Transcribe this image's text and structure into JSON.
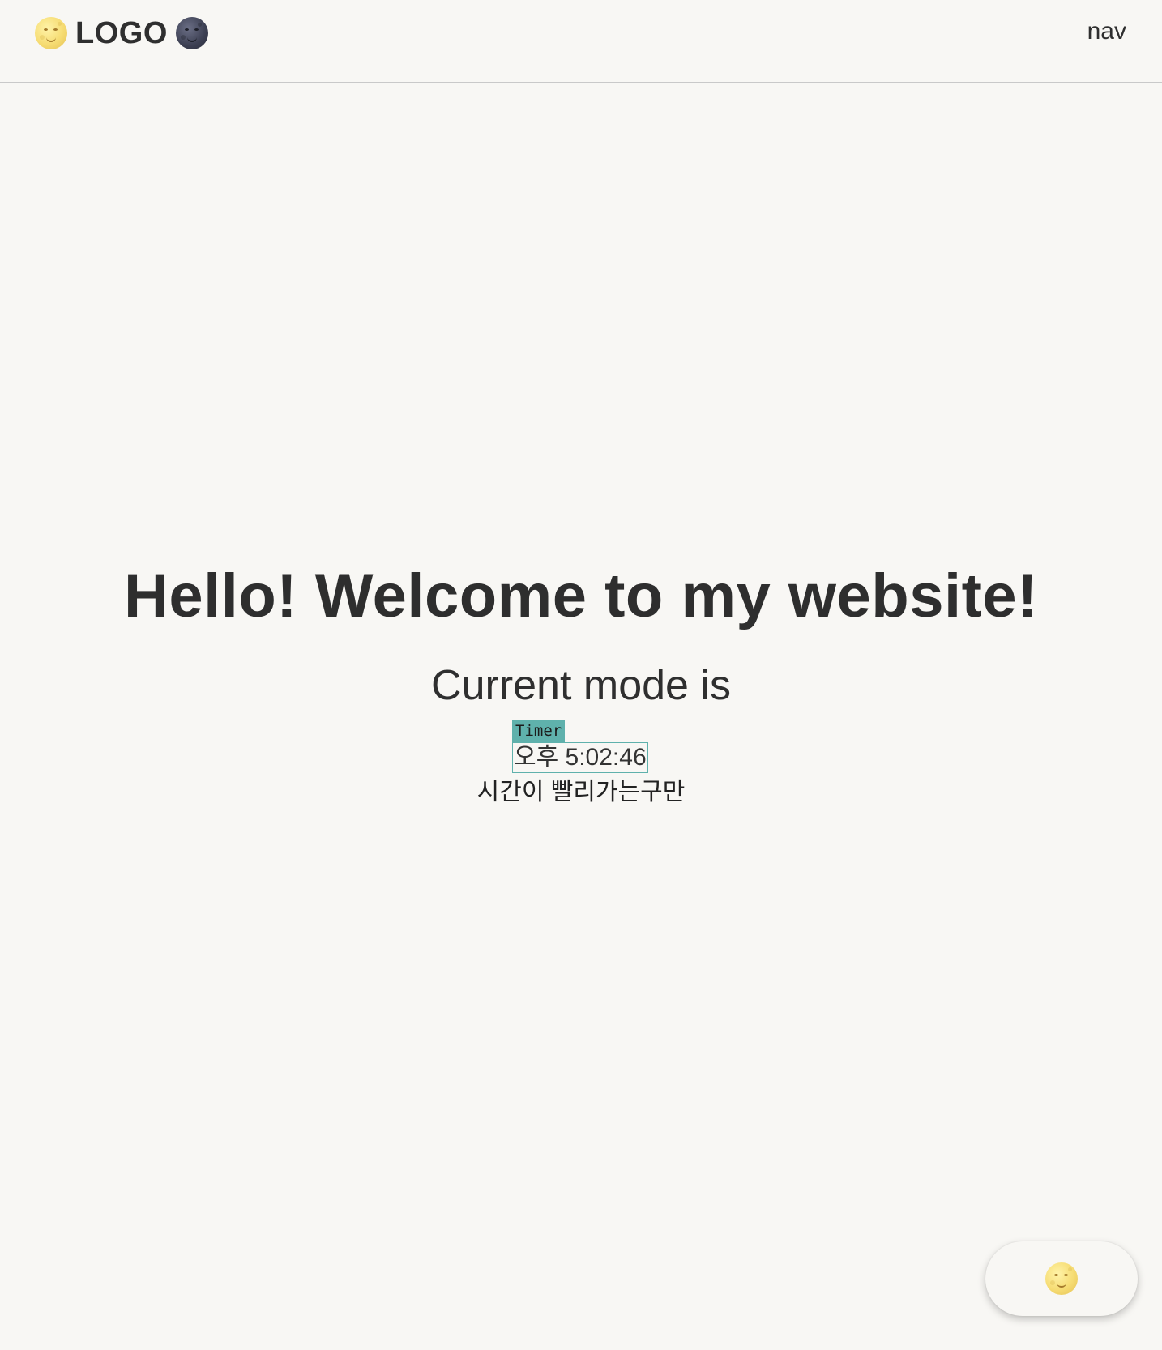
{
  "header": {
    "logo_text": "LOGO",
    "logo_left_icon": "full-moon-face-icon",
    "logo_right_icon": "new-moon-face-icon",
    "nav_label": "nav"
  },
  "main": {
    "title": "Hello! Welcome to my website!",
    "mode_text": "Current mode is",
    "timer_label": "Timer",
    "timer_value": "오후 5:02:46",
    "subtext": "시간이 빨리가는구만"
  },
  "toggle": {
    "icon": "full-moon-face-icon"
  },
  "colors": {
    "background": "#f8f7f4",
    "text": "#2f2f2f",
    "timer_accent": "#5fb1ac"
  }
}
